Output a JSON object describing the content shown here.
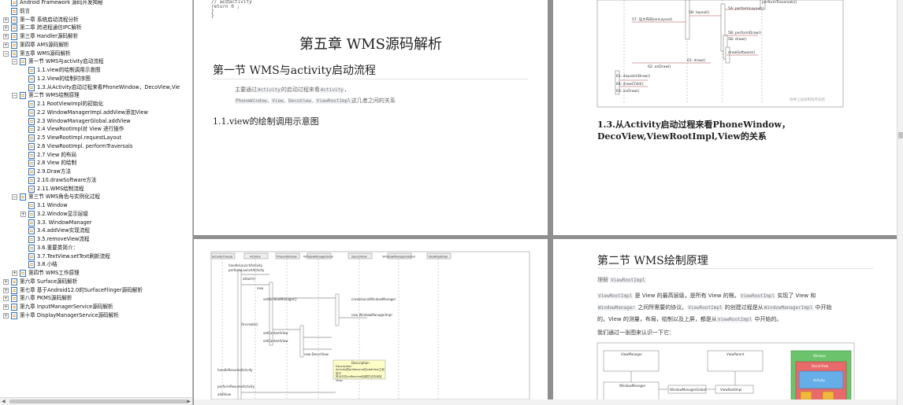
{
  "sidebar": {
    "items": [
      {
        "label": "Android Framework 源码开发揭秘",
        "depth": 0,
        "toggle": ""
      },
      {
        "label": "前言",
        "depth": 0,
        "toggle": ""
      },
      {
        "label": "第一章 系统启动流程分析",
        "depth": 0,
        "toggle": "+"
      },
      {
        "label": "第二章 跨进程通信IPC解析",
        "depth": 0,
        "toggle": "+"
      },
      {
        "label": "第三章 Handler源码解析",
        "depth": 0,
        "toggle": "+"
      },
      {
        "label": "第四章 AMS源码解析",
        "depth": 0,
        "toggle": "+"
      },
      {
        "label": "第五章 WMS源码解析",
        "depth": 0,
        "toggle": "−"
      },
      {
        "label": "第一节 WMS与activity启动流程",
        "depth": 1,
        "toggle": "−"
      },
      {
        "label": "1.1.view的绘制调用示意图",
        "depth": 2,
        "toggle": ""
      },
      {
        "label": "1.2.View的绘制时序图",
        "depth": 2,
        "toggle": ""
      },
      {
        "label": "1.3.从Activity启动过程来看PhoneWindow，DecoView,Vie",
        "depth": 2,
        "toggle": ""
      },
      {
        "label": "第二节 WMS绘制原理",
        "depth": 1,
        "toggle": "−"
      },
      {
        "label": "2.1 RootViewImpl的初始化",
        "depth": 2,
        "toggle": ""
      },
      {
        "label": "2.2 WindowManagerImpl.addView添加View",
        "depth": 2,
        "toggle": ""
      },
      {
        "label": "2.3 WindowManagerGlobal.addView",
        "depth": 2,
        "toggle": ""
      },
      {
        "label": "2.4 ViewRootImpl对 View 进行操作",
        "depth": 2,
        "toggle": ""
      },
      {
        "label": "2.5 ViewRootImpl.requestLayout",
        "depth": 2,
        "toggle": ""
      },
      {
        "label": "2.6 ViewRootImpl. performTraversals",
        "depth": 2,
        "toggle": ""
      },
      {
        "label": "2.7 View 的布局",
        "depth": 2,
        "toggle": ""
      },
      {
        "label": "2.8 View 的绘制",
        "depth": 2,
        "toggle": ""
      },
      {
        "label": "2.9.Draw方法",
        "depth": 2,
        "toggle": ""
      },
      {
        "label": "2.10.drawSoftware方法",
        "depth": 2,
        "toggle": ""
      },
      {
        "label": "2.11.WMS绘制流程",
        "depth": 2,
        "toggle": ""
      },
      {
        "label": "第三节 WMS角色与实例化过程",
        "depth": 1,
        "toggle": "−"
      },
      {
        "label": "3.1 Window",
        "depth": 2,
        "toggle": ""
      },
      {
        "label": "3.2.Window显示层级",
        "depth": 2,
        "toggle": "+"
      },
      {
        "label": "3.3. WindowManager",
        "depth": 2,
        "toggle": ""
      },
      {
        "label": "3.4.addView实现流程",
        "depth": 2,
        "toggle": ""
      },
      {
        "label": "3.5.removeView流程",
        "depth": 2,
        "toggle": ""
      },
      {
        "label": "3.6.重要类简介：",
        "depth": 2,
        "toggle": ""
      },
      {
        "label": "3.7.TextView.setText刷新流程",
        "depth": 2,
        "toggle": ""
      },
      {
        "label": "3.8.小结",
        "depth": 2,
        "toggle": ""
      },
      {
        "label": "第四节 WMS工作原理",
        "depth": 1,
        "toggle": "+"
      },
      {
        "label": "第六章 Surface源码解析",
        "depth": 0,
        "toggle": "+"
      },
      {
        "label": "第七章 基于Android12.0的SurfaceFlinger源码解析",
        "depth": 0,
        "toggle": "+"
      },
      {
        "label": "第八章 PKMS源码解析",
        "depth": 0,
        "toggle": "+"
      },
      {
        "label": "第九章 InputManagerService源码解析",
        "depth": 0,
        "toggle": "+"
      },
      {
        "label": "第十章 DisplayManagerService源码解析",
        "depth": 0,
        "toggle": "+"
      }
    ]
  },
  "page1": {
    "code": "// 启动activity\nreturn 0 ;\n}\n}",
    "chapter_title": "第五章 WMS源码解析",
    "section_title": "第一节 WMS与activity启动流程",
    "intro_prefix": "主要通过",
    "intro_tag1": "Activity",
    "intro_mid": "的启动过程来看",
    "intro_tag2": "Activity",
    "intro_end": "，",
    "intro_line2_tags": [
      "PhoneWindow",
      "View",
      "DecoView",
      "ViewRootImpl"
    ],
    "intro_line2_end": "这几者之间的关系",
    "subsection": "1.1.view的绘制调用示意图"
  },
  "page2": {
    "diagram_labels": [
      "5B: layout()",
      "57: 设大布局(onLayout)",
      "5A: performLayout()",
      "performTraversals()",
      "5B: performDraw()",
      "5B: draw()",
      "drawSoftware()",
      "61: draw()",
      "62: onDraw()",
      "61: dispatchDraw()",
      "64: drawChild()",
      "63: onDraw()",
      "各种上层绘制程序总结"
    ],
    "heading": "1.3.从Activity启动过程来看PhoneWindow，DecoView,ViewRootImpl,View的关系"
  },
  "page3": {
    "columns": [
      "ActivityThread",
      "Activity",
      "PhoneWindow",
      "WindowManagerImpl",
      "DecorView",
      "WindowManagerGlobal",
      "ViewRootImpl"
    ],
    "labels": [
      "handleLaunchActivity",
      "performLaunchActivity",
      "attach()",
      "new",
      "setWindowManager()",
      "createLocalWindowManager",
      "new WindowManagerImpl",
      "Oncreate()",
      "setContentView",
      "setContentView",
      "new DecorView",
      "Description",
      "handleResumeActivity",
      "performResumeActivity",
      "addView"
    ],
    "note": "Description\nActivity的onResume在addView之前执行\n所以可在onResume回调方法中添加View"
  },
  "page4": {
    "section_title": "第二节 WMS绘制原理",
    "understand": "理解",
    "understand_tag": "ViewRootImpl",
    "p1_tag1": "ViewRootImpl",
    "p1_a": "是 View 的最高层级，是所有 View 的根。",
    "p1_tag2": "ViewRootImpl",
    "p1_b": "实现了 View 和",
    "p2_tag1": "WindowManager",
    "p2_a": "之间所需要的协议。",
    "p2_tag2": "ViewRootImpl",
    "p2_b": "的创建过程是从",
    "p2_tag3": "WindowManagerImpl",
    "p2_c": "中开始",
    "p3_a": "的。View 的测量，布局，绘制以及上屏，都是从",
    "p3_tag": "ViewRootImpl",
    "p3_b": "中开始的。",
    "p4": "我们通过一张图来认识一下它：",
    "diagram_labels": [
      "ViewManager",
      "ViewParent",
      "WindowManager",
      "WindowManagerGlobal",
      "ViewRootImpl",
      "Window",
      "DecorView",
      "Activity",
      "WindowManagerImpl"
    ]
  }
}
